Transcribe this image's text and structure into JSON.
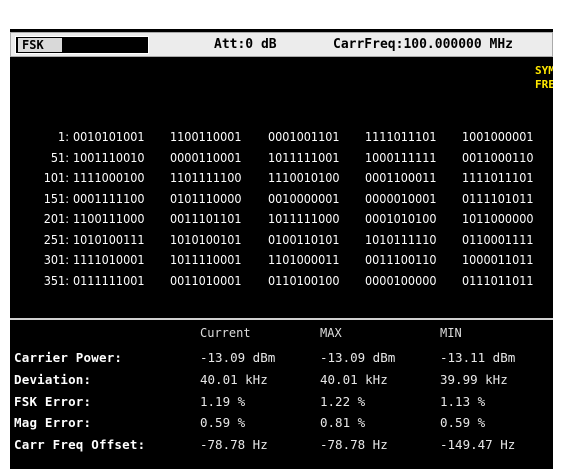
{
  "status_bar": {
    "mode": "FSK",
    "attenuation": "Att:0 dB",
    "carrier_frequency": "CarrFreq:100.000000 MHz"
  },
  "symbol_indicator": "SYMBOL FREQ",
  "bits": [
    {
      "index": "1:",
      "words": [
        "0010101001",
        "1100110001",
        "0001001101",
        "1111011101",
        "1001000001"
      ]
    },
    {
      "index": "51:",
      "words": [
        "1001110010",
        "0000110001",
        "1011111001",
        "1000111111",
        "0011000110"
      ]
    },
    {
      "index": "101:",
      "words": [
        "1111000100",
        "1101111100",
        "1110010100",
        "0001100011",
        "1111011101"
      ]
    },
    {
      "index": "151:",
      "words": [
        "0001111100",
        "0101110000",
        "0010000001",
        "0000010001",
        "0111101011"
      ]
    },
    {
      "index": "201:",
      "words": [
        "1100111000",
        "0011101101",
        "1011111000",
        "0001010100",
        "1011000000"
      ]
    },
    {
      "index": "251:",
      "words": [
        "1010100111",
        "1010100101",
        "0100110101",
        "1010111110",
        "0110001111"
      ]
    },
    {
      "index": "301:",
      "words": [
        "1111010001",
        "1011110001",
        "1101000011",
        "0011100110",
        "1000011011"
      ]
    },
    {
      "index": "351:",
      "words": [
        "0111111001",
        "0011010001",
        "0110100100",
        "0000100000",
        "0111011011"
      ]
    }
  ],
  "measurements": {
    "headers": {
      "current": "Current",
      "max": "MAX",
      "min": "MIN"
    },
    "rows": [
      {
        "label": "Carrier Power:",
        "current": "-13.09 dBm",
        "max": "-13.09 dBm",
        "min": "-13.11 dBm"
      },
      {
        "label": "Deviation:",
        "current": "40.01 kHz",
        "max": "40.01 kHz",
        "min": "39.99 kHz"
      },
      {
        "label": "FSK Error:",
        "current": "1.19 %",
        "max": "1.22 %",
        "min": "1.13 %"
      },
      {
        "label": "Mag Error:",
        "current": "0.59 %",
        "max": "0.81 %",
        "min": "0.59 %"
      },
      {
        "label": "Carr Freq Offset:",
        "current": "-78.78 Hz",
        "max": "-78.78 Hz",
        "min": "-149.47 Hz"
      }
    ]
  }
}
